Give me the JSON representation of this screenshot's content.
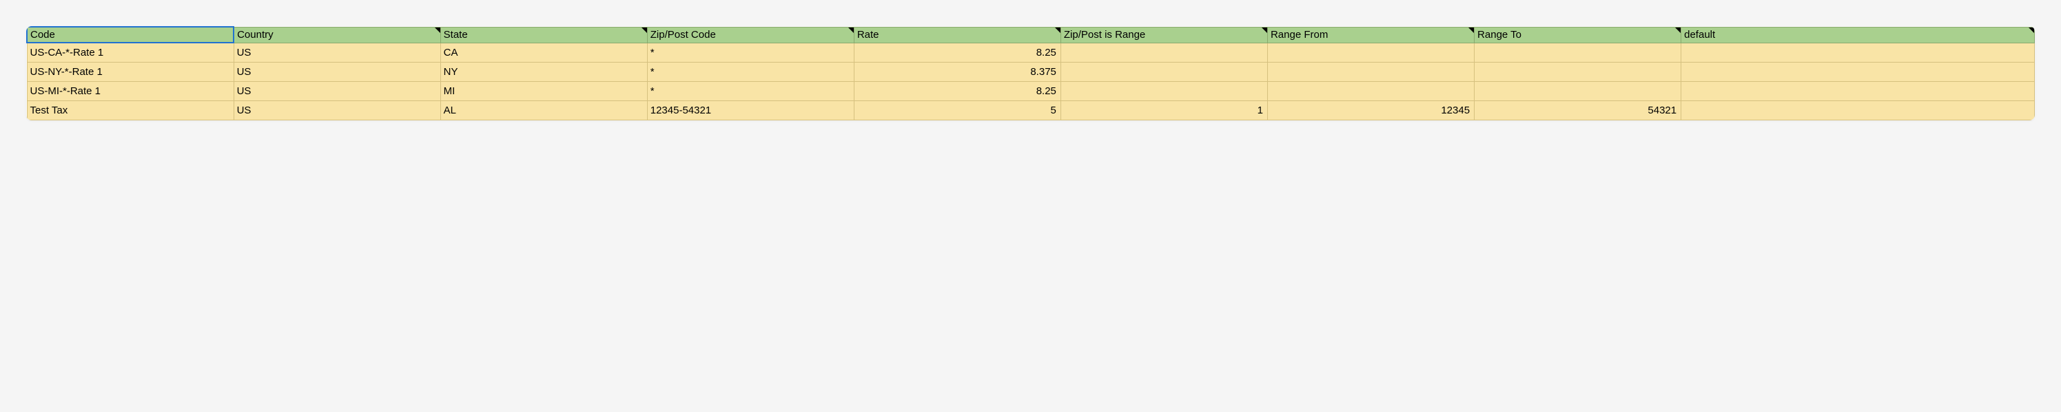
{
  "table": {
    "headers": [
      {
        "label": "Code",
        "selected": true,
        "mark": false
      },
      {
        "label": "Country",
        "selected": false,
        "mark": true
      },
      {
        "label": "State",
        "selected": false,
        "mark": true
      },
      {
        "label": "Zip/Post Code",
        "selected": false,
        "mark": true
      },
      {
        "label": "Rate",
        "selected": false,
        "mark": true
      },
      {
        "label": "Zip/Post is Range",
        "selected": false,
        "mark": true
      },
      {
        "label": "Range From",
        "selected": false,
        "mark": true
      },
      {
        "label": "Range To",
        "selected": false,
        "mark": true
      },
      {
        "label": "default",
        "selected": false,
        "mark": true
      }
    ],
    "rows": [
      {
        "code": "US-CA-*-Rate 1",
        "country": "US",
        "state": "CA",
        "zip": "*",
        "rate": "8.25",
        "is_range": "",
        "range_from": "",
        "range_to": "",
        "default": ""
      },
      {
        "code": "US-NY-*-Rate 1",
        "country": "US",
        "state": "NY",
        "zip": "*",
        "rate": "8.375",
        "is_range": "",
        "range_from": "",
        "range_to": "",
        "default": ""
      },
      {
        "code": "US-MI-*-Rate 1",
        "country": "US",
        "state": "MI",
        "zip": "*",
        "rate": "8.25",
        "is_range": "",
        "range_from": "",
        "range_to": "",
        "default": ""
      },
      {
        "code": "Test Tax",
        "country": "US",
        "state": "AL",
        "zip": "12345-54321",
        "rate": "5",
        "is_range": "1",
        "range_from": "12345",
        "range_to": "54321",
        "default": ""
      }
    ]
  }
}
